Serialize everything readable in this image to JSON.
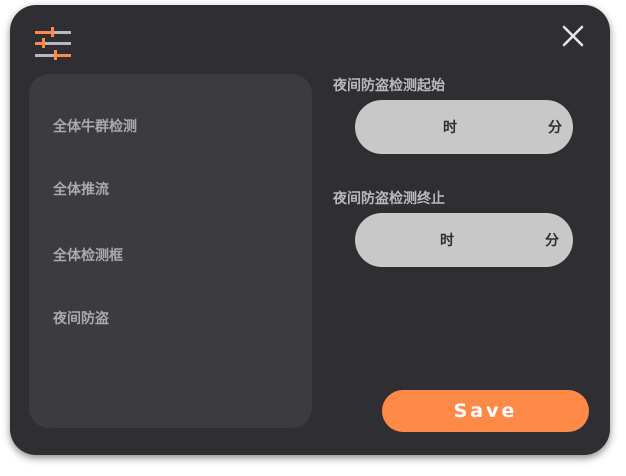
{
  "colors": {
    "dialog_bg": "#2f2f33",
    "panel_bg": "#3b3b40",
    "accent": "#ff8a48",
    "field_bg": "#c8c8c8",
    "close_icon": "#e6e6e6"
  },
  "header": {
    "settings_icon": "sliders-icon",
    "close_icon": "close-icon"
  },
  "menu": {
    "items": [
      {
        "label": "全体牛群检测"
      },
      {
        "label": "全体推流"
      },
      {
        "label": "全体检测框"
      },
      {
        "label": "夜间防盗"
      }
    ]
  },
  "night_start": {
    "label": "夜间防盗检测起始",
    "hour_unit": "时",
    "minute_unit": "分"
  },
  "night_end": {
    "label": "夜间防盗检测终止",
    "hour_unit": "时",
    "minute_unit": "分"
  },
  "save_label": "Save"
}
